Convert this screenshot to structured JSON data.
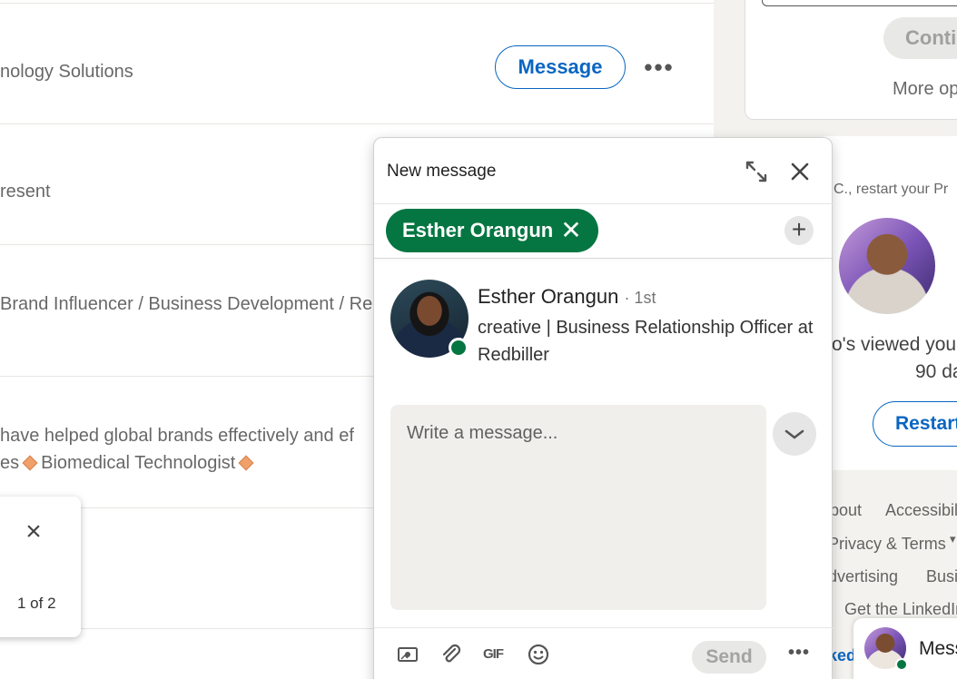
{
  "feed": {
    "row1_text": "nology Solutions",
    "message_button": "Message",
    "more_label": "•••",
    "row2_text": "resent",
    "row3_text": "Brand Influencer / Business Development / Re",
    "row4_line1": "have helped global brands effectively and ef",
    "row4_line2_a": "es",
    "row4_line2_b": "Biomedical Technologist"
  },
  "mini_popup": {
    "close_label": "×",
    "pager": "1 of 2"
  },
  "sidebar": {
    "continue_button": "Conti",
    "more_options": "More op",
    "restart_line": "C., restart your Pr",
    "viewed_line": "o's viewed you",
    "days_line": "90 da",
    "restart_button": "Restart",
    "footer_links": [
      "bout",
      "Accessibili",
      "Privacy & Terms",
      "dvertising",
      "Busi",
      "Get the LinkedIn"
    ],
    "linkedin_partial": "ked",
    "messaging_label": "Mess"
  },
  "dialog": {
    "title": "New message",
    "recipient_chip": "Esther Orangun",
    "chip_remove": "✕",
    "add_label": "+",
    "profile": {
      "name": "Esther Orangun",
      "degree": "· 1st",
      "headline": "creative | Business Relationship Officer at Redbiller"
    },
    "message_placeholder": "Write a message...",
    "gif_label": "GIF",
    "send_label": "Send",
    "more_label": "•••"
  }
}
